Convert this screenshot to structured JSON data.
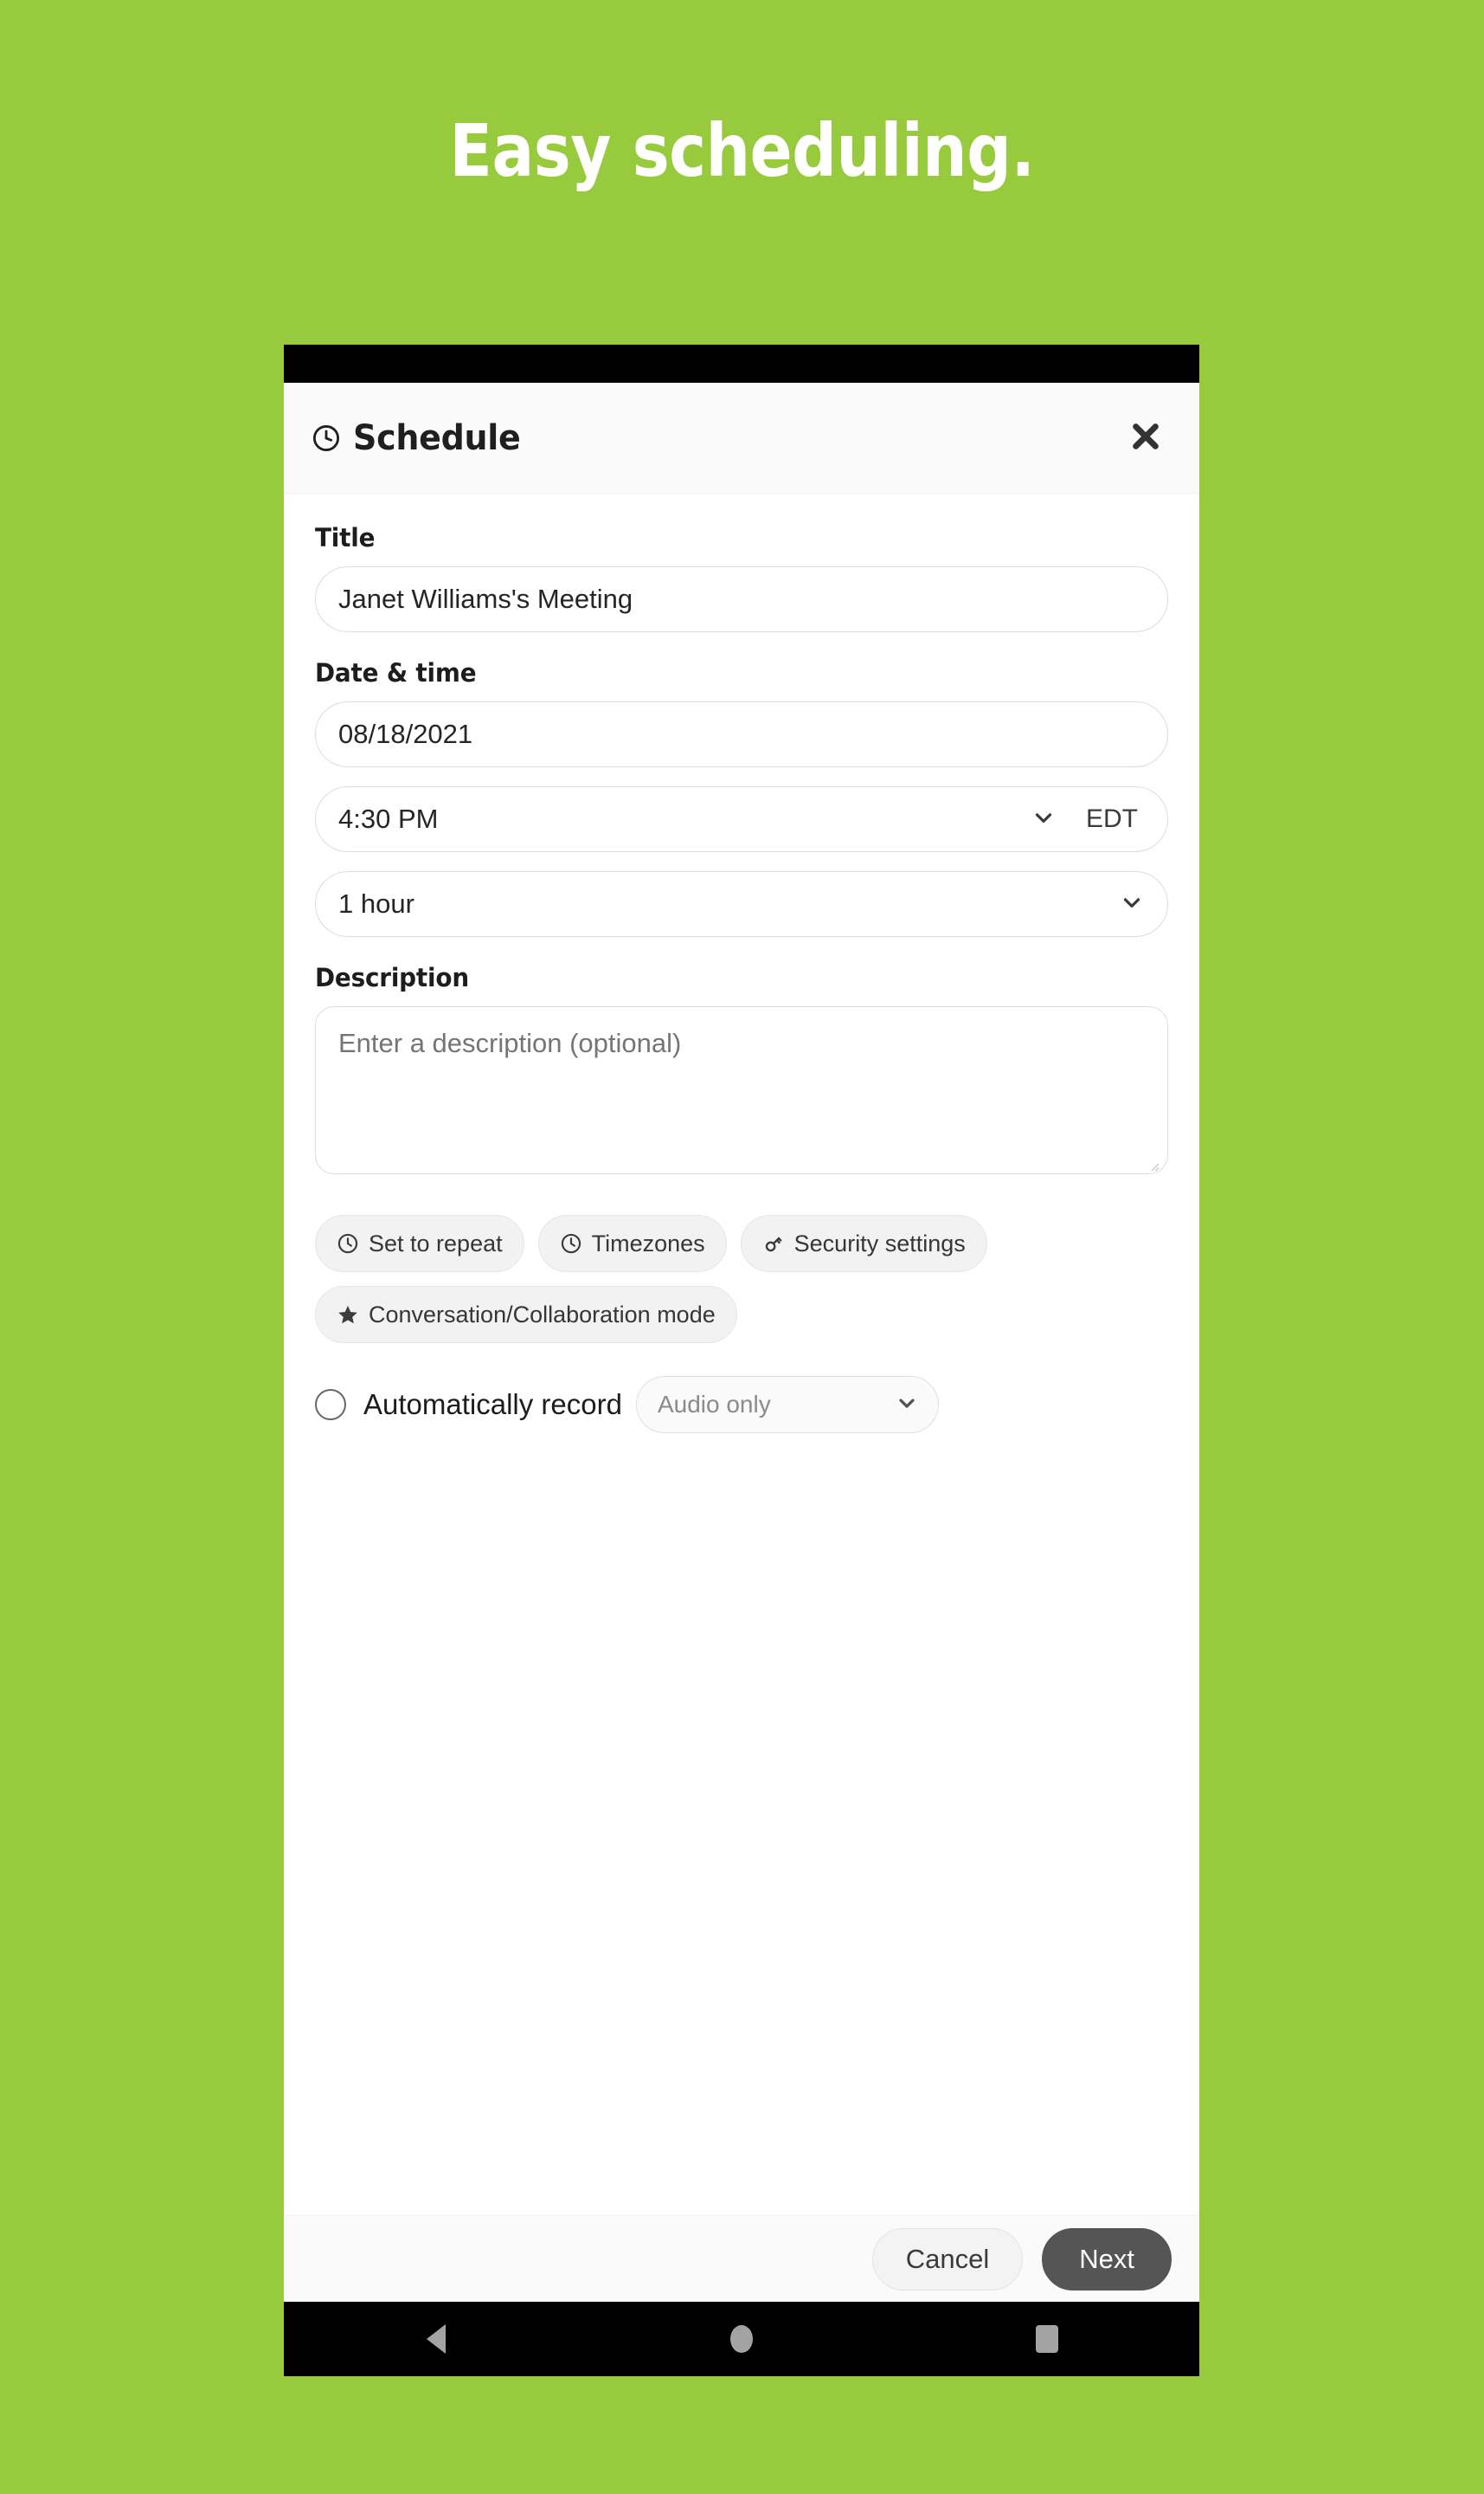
{
  "hero": {
    "title": "Easy scheduling."
  },
  "colors": {
    "background_green": "#97ca3c",
    "primary_button": "#555555",
    "text_dark": "#1d1d1d",
    "placeholder": "#9a9a9a",
    "chip_background": "#f2f2f2",
    "nav_icon": "#a3a3a3"
  },
  "phone": {
    "status_bar": "",
    "header": {
      "icon": "clock-icon",
      "title": "Schedule",
      "close_icon": "close-icon"
    },
    "form": {
      "title": {
        "label": "Title",
        "value": "Janet Williams's Meeting"
      },
      "datetime": {
        "label": "Date & time",
        "date_value": "08/18/2021",
        "time_value": "4:30 PM",
        "timezone": "EDT",
        "duration_value": "1 hour",
        "chevron_icon": "chevron-down-icon"
      },
      "description": {
        "label": "Description",
        "value": "",
        "placeholder": "Enter a description (optional)"
      },
      "chips": [
        {
          "icon": "clock-icon",
          "label": "Set to repeat"
        },
        {
          "icon": "clock-icon",
          "label": "Timezones"
        },
        {
          "icon": "key-icon",
          "label": "Security settings"
        },
        {
          "icon": "star-icon",
          "label": "Conversation/Collaboration mode"
        }
      ],
      "record": {
        "radio_checked": false,
        "label": "Automatically record",
        "select_value": "Audio only",
        "chevron_icon": "chevron-down-icon"
      }
    },
    "footer": {
      "cancel_label": "Cancel",
      "next_label": "Next"
    },
    "nav_bar": {
      "back_icon": "back-triangle-icon",
      "home_icon": "home-circle-icon",
      "recents_icon": "recents-square-icon"
    }
  }
}
